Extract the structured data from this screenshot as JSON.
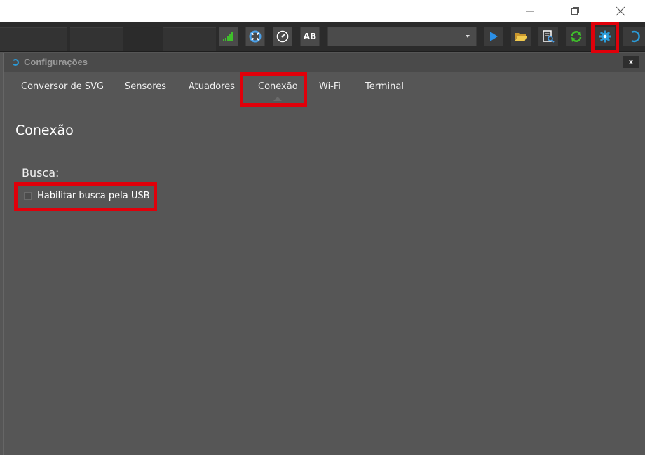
{
  "window": {
    "controls": {
      "minimize_icon": "minimize-icon",
      "maximize_icon": "restore-icon",
      "close_icon": "close-icon"
    }
  },
  "toolbar": {
    "buttons": [
      {
        "name": "signal-button",
        "icon": "signal-bars-icon",
        "color": "#3fbf2b"
      },
      {
        "name": "help-button",
        "icon": "lifebuoy-icon",
        "color": "#4aa0e8"
      },
      {
        "name": "gauge-button",
        "icon": "gauge-icon",
        "color": "#ffffff"
      },
      {
        "name": "ab-button",
        "label": "AB"
      },
      {
        "name": "play-button",
        "icon": "play-icon",
        "color": "#2b8fe6"
      },
      {
        "name": "open-folder-button",
        "icon": "folder-open-icon",
        "color": "#e8c04a"
      },
      {
        "name": "inspect-file-button",
        "icon": "file-search-icon",
        "color": "#ffffff"
      },
      {
        "name": "refresh-button",
        "icon": "refresh-icon",
        "color": "#3fbf2b"
      },
      {
        "name": "settings-button",
        "icon": "gear-icon",
        "color": "#2b9bd8"
      }
    ],
    "combo": {
      "value": ""
    }
  },
  "panel": {
    "title": "Configurações",
    "close_label": "x",
    "tabs": [
      {
        "label": "Conversor de SVG",
        "active": false
      },
      {
        "label": "Sensores",
        "active": false
      },
      {
        "label": "Atuadores",
        "active": false
      },
      {
        "label": "Conexão",
        "active": true
      },
      {
        "label": "Wi-Fi",
        "active": false
      },
      {
        "label": "Terminal",
        "active": false
      }
    ],
    "heading": "Conexão",
    "section_label": "Busca:",
    "usb_search": {
      "label": "Habilitar busca pela USB",
      "checked": false
    }
  },
  "colors": {
    "highlight": "#e0000a",
    "accent": "#2b9bd8",
    "background": "#565656"
  }
}
